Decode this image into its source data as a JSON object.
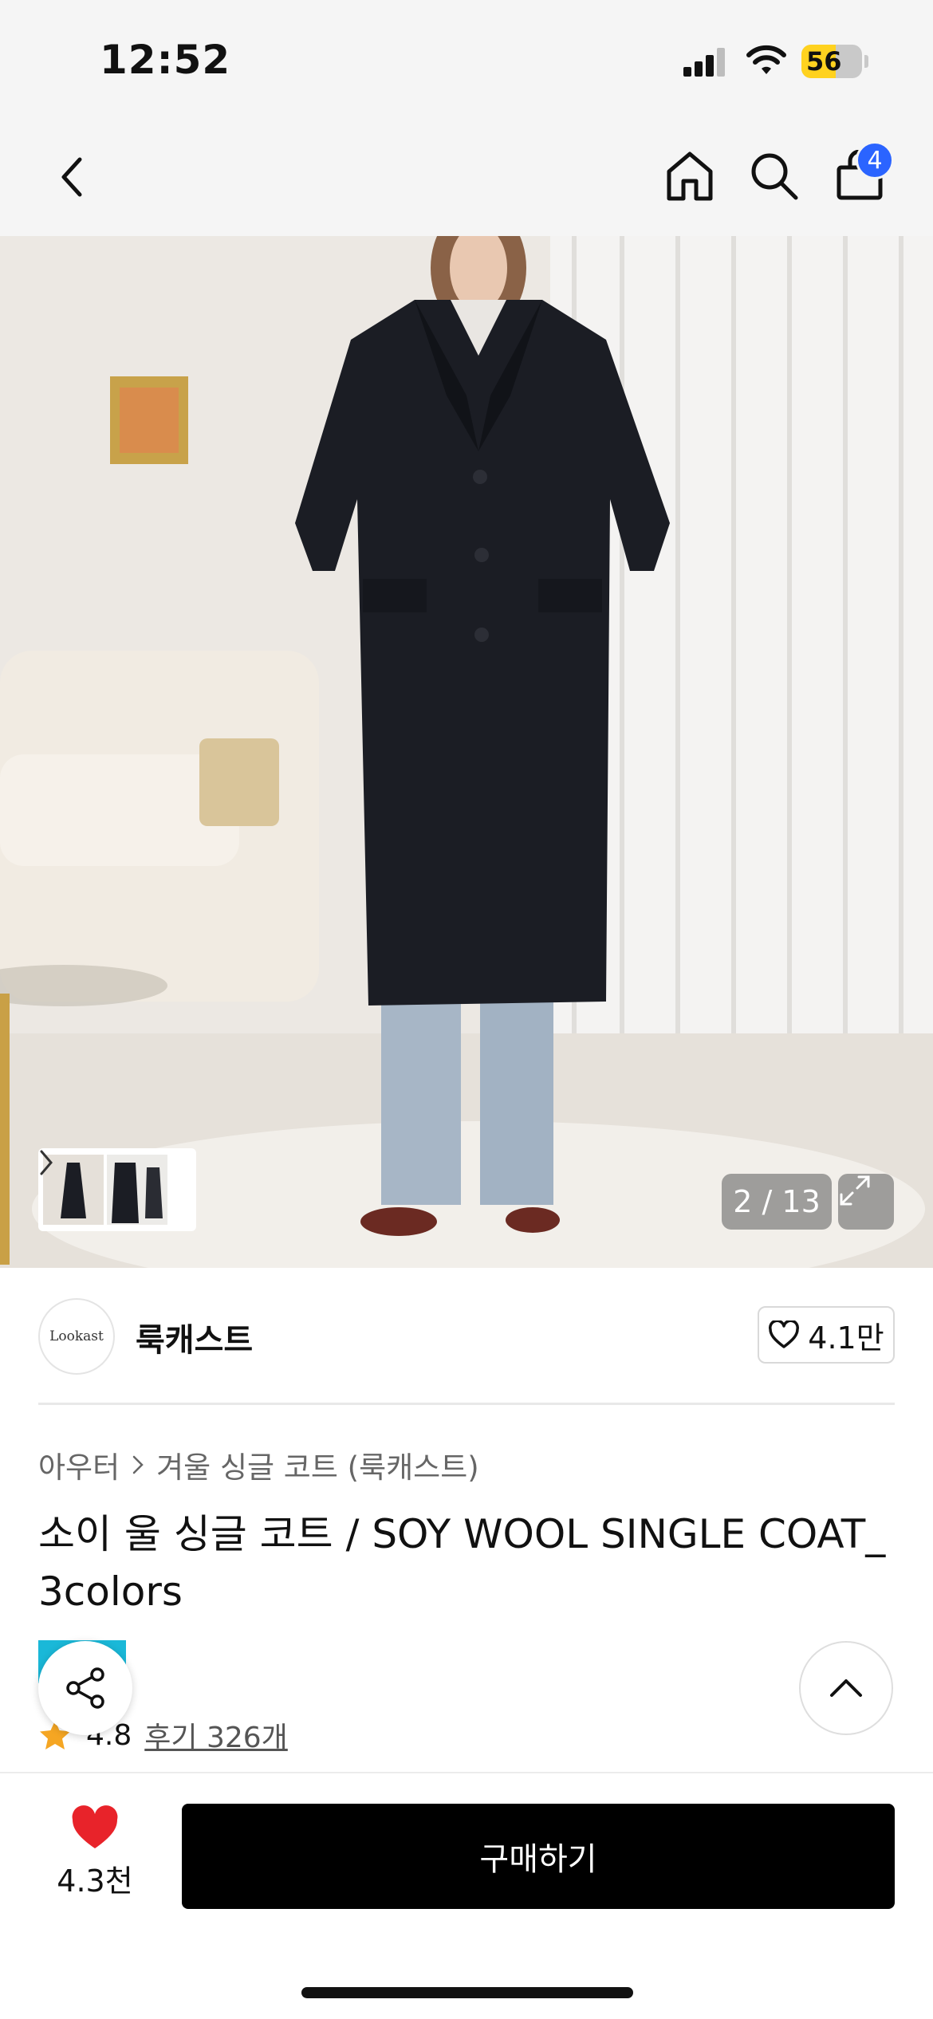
{
  "status_bar": {
    "time": "12:52",
    "battery": "56",
    "battery_level": 0.56,
    "signal_icon": "signal-bars-icon",
    "wifi_icon": "wifi-icon"
  },
  "nav": {
    "back_icon": "chevron-left-icon",
    "home_icon": "home-icon",
    "search_icon": "search-icon",
    "cart_icon": "shopping-bag-icon",
    "cart_count": "4",
    "badge_color": "#2b64ff"
  },
  "gallery": {
    "current": "2 / 13",
    "expand_icon": "expand-icon",
    "thumb_arrow_icon": "chevron-right-icon"
  },
  "brand": {
    "logo_text": "Lookast",
    "name": "룩캐스트",
    "likes": "4.1만",
    "like_icon": "heart-outline-icon"
  },
  "product": {
    "breadcrumb": [
      "아우터",
      "겨울 싱글 코트 (룩캐스트)"
    ],
    "title": "소이 울 싱글 코트 / SOY WOOL SINGLE COAT_ 3colors",
    "rating": "4.8",
    "reviews": "후기 326개",
    "star_color": "#f5a623"
  },
  "floating": {
    "share_icon": "share-icon",
    "scroll_top_icon": "chevron-up-icon"
  },
  "bottom_bar": {
    "wish_icon": "heart-filled-icon",
    "wish_count": "4.3천",
    "wish_color": "#e8232a",
    "buy_label": "구매하기"
  }
}
